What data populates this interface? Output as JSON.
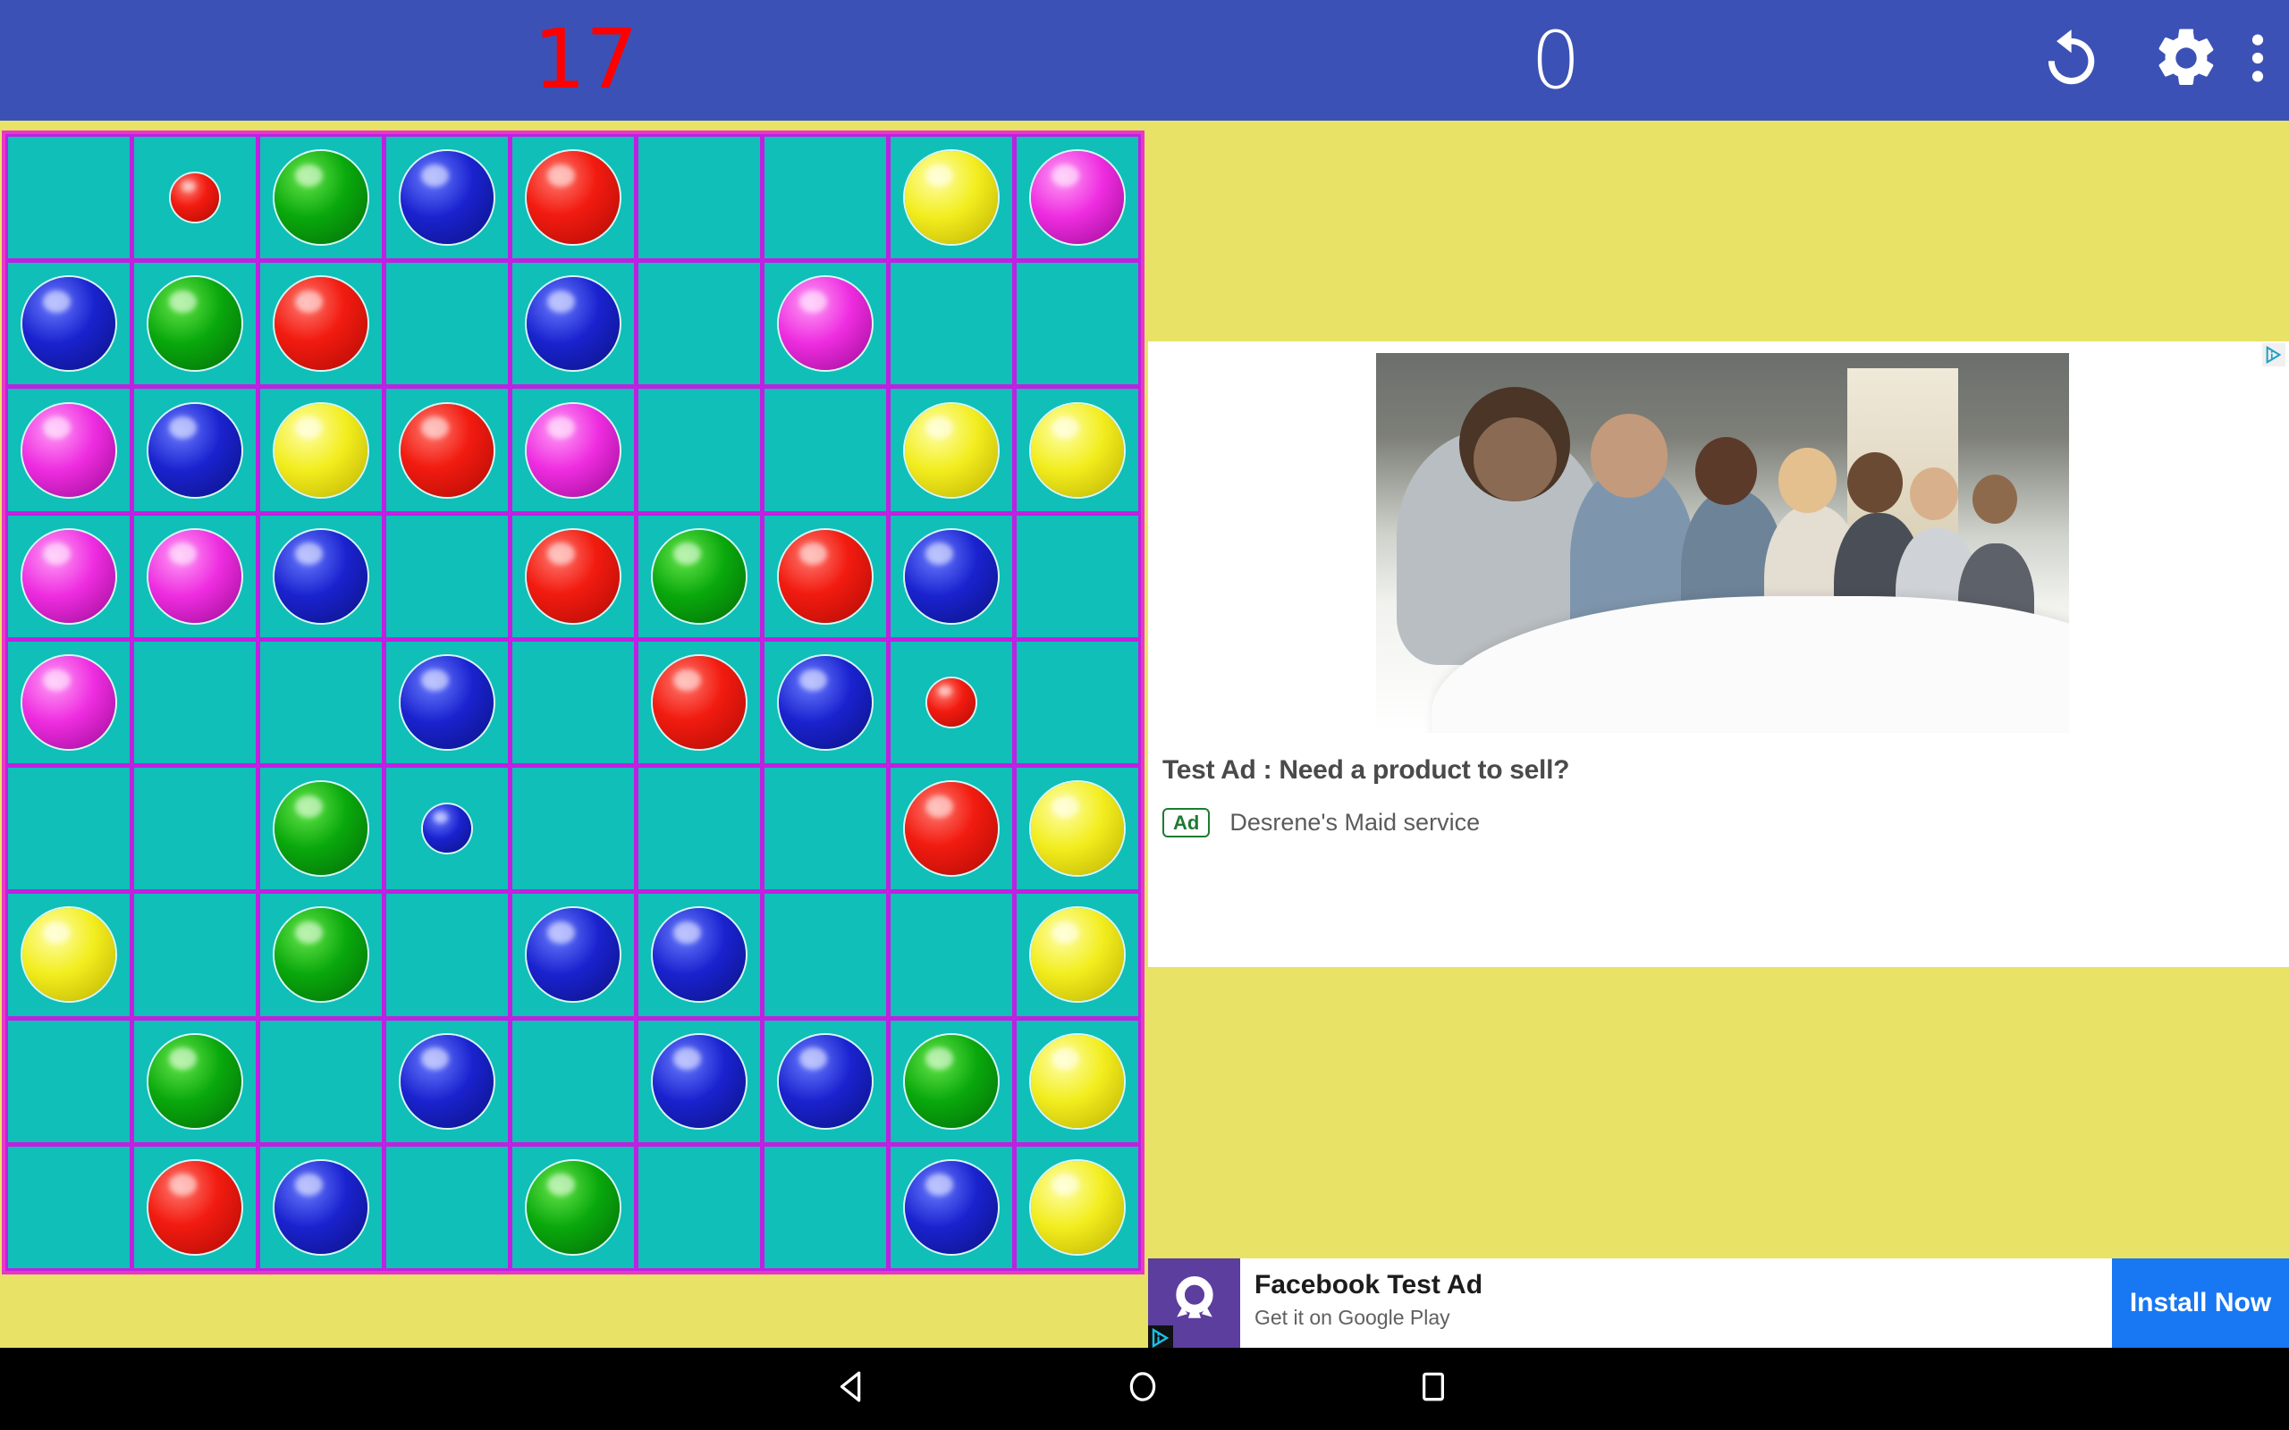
{
  "appbar": {
    "level_value": "17",
    "score_value": "0",
    "undo_icon": "undo-rotate-icon",
    "settings_icon": "gear-icon",
    "more_icon": "more-vertical-icon",
    "background_color": "#3C51B5",
    "level_color": "#FF0000",
    "score_color": "#FFFFFF"
  },
  "board": {
    "rows": 9,
    "cols": 9,
    "cell_color": "#0FBFB8",
    "grid_line_color": "#C020E0",
    "border_color": "#E838C8",
    "ball_colors": {
      "red": "#F21B10",
      "green": "#09A80C",
      "blue": "#1A22CF",
      "yellow": "#F2ED1E",
      "magenta": "#EE2CE0"
    },
    "cells": [
      [
        null,
        "red-small",
        "green",
        "blue",
        "red",
        null,
        null,
        "yellow",
        "magenta"
      ],
      [
        "blue",
        "green",
        "red",
        null,
        "blue",
        null,
        "magenta",
        null,
        null
      ],
      [
        "magenta",
        "blue",
        "yellow",
        "red",
        "magenta",
        null,
        null,
        "yellow",
        "yellow"
      ],
      [
        "magenta",
        "magenta",
        "blue",
        null,
        "red",
        "green",
        "red",
        "blue",
        null
      ],
      [
        "magenta",
        null,
        null,
        "blue",
        null,
        "red",
        "blue",
        "red-small",
        null
      ],
      [
        null,
        null,
        "green",
        "blue-small",
        null,
        null,
        null,
        "red",
        "yellow"
      ],
      [
        "yellow",
        null,
        "green",
        null,
        "blue",
        "blue",
        null,
        null,
        "yellow"
      ],
      [
        null,
        "green",
        null,
        "blue",
        null,
        "blue",
        "blue",
        "green",
        "yellow"
      ],
      [
        null,
        "red",
        "blue",
        null,
        "green",
        null,
        null,
        "blue",
        "yellow"
      ]
    ]
  },
  "background": {
    "page_color": "#E8E266"
  },
  "native_ad": {
    "title": "Test Ad : Need a product to sell?",
    "badge": "Ad",
    "advertiser": "Desrene's Maid service",
    "adchoices_icon": "adchoices-icon",
    "image_alt": "business-team-meeting-photo",
    "background_color": "#FFFFFF"
  },
  "banner_ad": {
    "title": "Facebook Test Ad",
    "subtitle": "Get it on Google Play",
    "cta_label": "Install Now",
    "icon": "rocket-icon",
    "icon_bg_color": "#5B3E9E",
    "cta_bg_color": "#1877F2",
    "adchoices_icon": "adchoices-icon"
  },
  "navbar": {
    "back_icon": "back-triangle-icon",
    "home_icon": "home-circle-icon",
    "recents_icon": "recents-square-icon",
    "background_color": "#000000"
  }
}
